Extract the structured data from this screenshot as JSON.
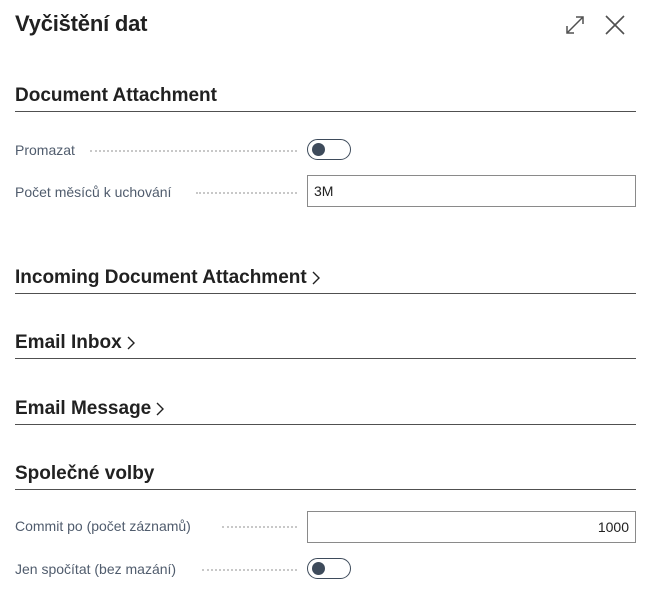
{
  "dialog": {
    "title": "Vyčištění dat",
    "expand_icon": "expand-icon",
    "close_icon": "close-icon"
  },
  "sections": {
    "document_attachment": {
      "title": "Document Attachment",
      "fields": {
        "promazat": {
          "label": "Promazat",
          "value": false
        },
        "pocet_mesicu": {
          "label": "Počet měsíců k uchování",
          "value": "3M"
        }
      }
    },
    "incoming_document_attachment": {
      "title": "Incoming Document Attachment",
      "collapsed": true
    },
    "email_inbox": {
      "title": "Email Inbox",
      "collapsed": true
    },
    "email_message": {
      "title": "Email Message",
      "collapsed": true
    },
    "spolecne_volby": {
      "title": "Společné volby",
      "fields": {
        "commit_po": {
          "label": "Commit po (počet záznamů)",
          "value": "1000"
        },
        "jen_spocitat": {
          "label": "Jen spočítat (bez mazání)",
          "value": false
        }
      }
    }
  },
  "colors": {
    "text": "#212121",
    "label": "#505c6d",
    "toggle": "#3e4b5b",
    "divider": "#505050"
  }
}
